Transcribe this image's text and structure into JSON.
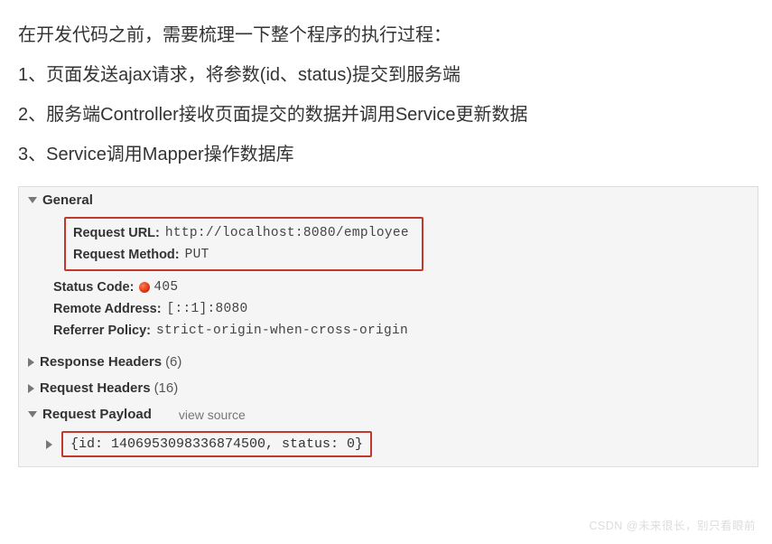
{
  "intro": {
    "line0": "在开发代码之前，需要梳理一下整个程序的执行过程：",
    "line1": "1、页面发送ajax请求，将参数(id、status)提交到服务端",
    "line2": "2、服务端Controller接收页面提交的数据并调用Service更新数据",
    "line3": "3、Service调用Mapper操作数据库"
  },
  "devtools": {
    "general": {
      "title": "General",
      "request_url_label": "Request URL:",
      "request_url_value": "http://localhost:8080/employee",
      "request_method_label": "Request Method:",
      "request_method_value": "PUT",
      "status_code_label": "Status Code:",
      "status_code_value": "405",
      "remote_address_label": "Remote Address:",
      "remote_address_value": "[::1]:8080",
      "referrer_policy_label": "Referrer Policy:",
      "referrer_policy_value": "strict-origin-when-cross-origin"
    },
    "response_headers": {
      "title": "Response Headers",
      "count": "(6)"
    },
    "request_headers": {
      "title": "Request Headers",
      "count": "(16)"
    },
    "request_payload": {
      "title": "Request Payload",
      "view_source": "view source",
      "content": "{id: 1406953098336874500, status: 0}"
    }
  },
  "watermark": "CSDN @未来很长，别只看眼前"
}
